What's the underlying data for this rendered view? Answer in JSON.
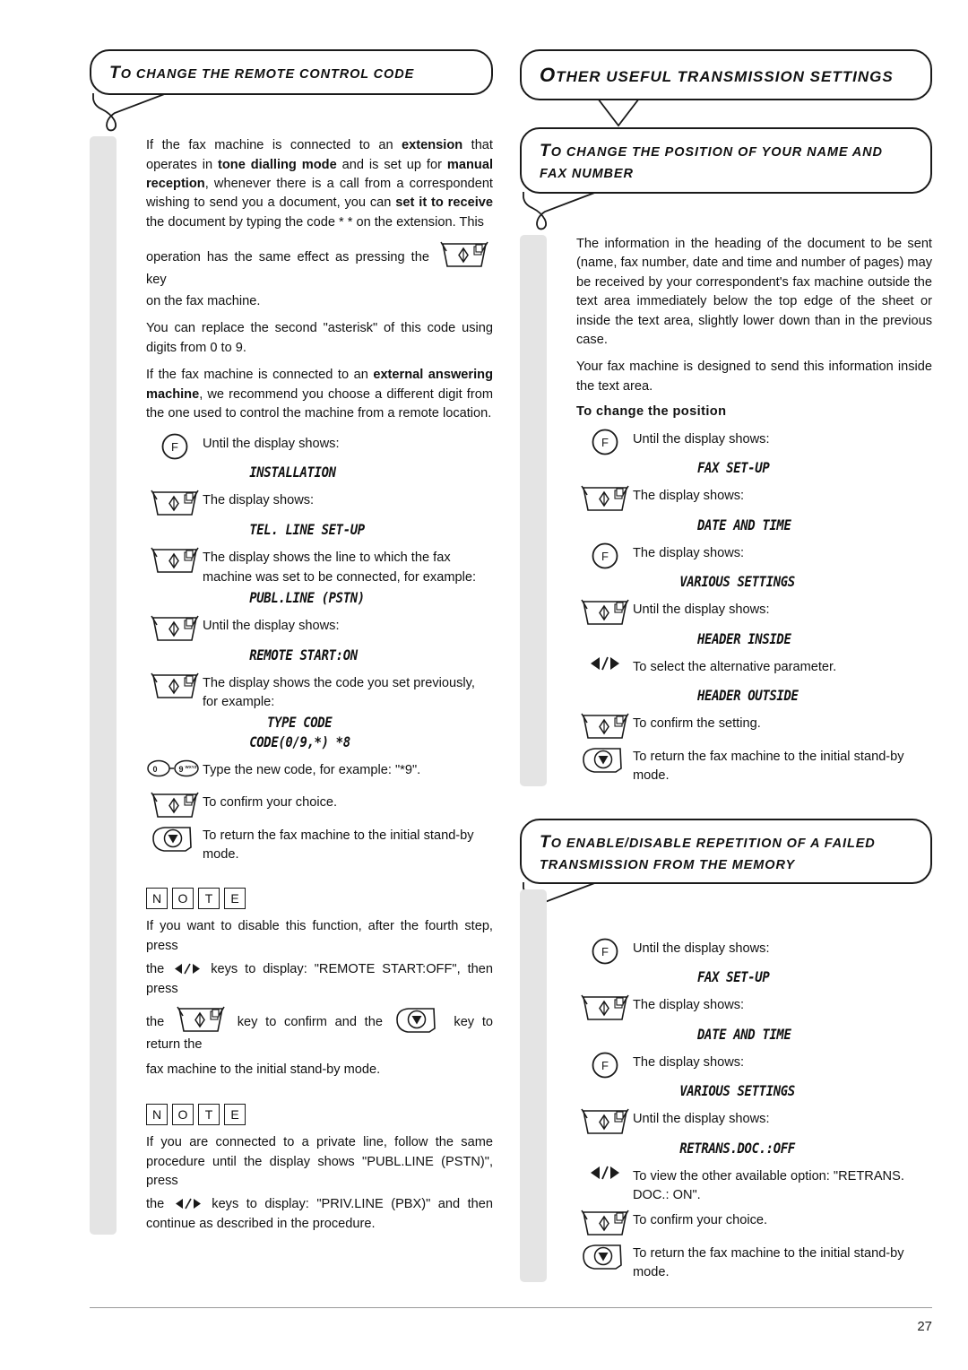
{
  "page": {
    "number": "27"
  },
  "left": {
    "header": {
      "cap": "T",
      "rest": "o change the remote control code"
    },
    "intro": [
      {
        "runs": [
          {
            "t": "If the fax machine is connected to an ",
            "b": false
          },
          {
            "t": "extension",
            "b": true
          },
          {
            "t": " that operates in ",
            "b": false
          },
          {
            "t": "tone dialling mode",
            "b": true
          },
          {
            "t": " and is set up for ",
            "b": false
          },
          {
            "t": "manual reception",
            "b": true
          },
          {
            "t": ", whenever there is a call from a  correspondent wishing to send you a document, you can ",
            "b": false
          },
          {
            "t": "set it to receive",
            "b": true
          },
          {
            "t": " the document by typing the code * * on the extension. This",
            "b": false
          }
        ]
      }
    ],
    "para_key_before": "operation has the same effect as pressing the",
    "para_key_after": "key",
    "para_key_line2": "on the fax machine.",
    "para_asterisk": "You can replace the second \"asterisk\" of this code using digits from 0 to 9.",
    "para_ansmachine": [
      {
        "t": "If the fax machine is connected to an ",
        "b": false
      },
      {
        "t": "external answering machine",
        "b": true
      },
      {
        "t": ", we recommend you choose a different digit from the one used to control the machine from a remote location.",
        "b": false
      }
    ],
    "steps": [
      {
        "key": "f-key",
        "desc": "Until the display shows:",
        "lcd": "INSTALLATION",
        "lcd_indent": "ind3"
      },
      {
        "key": "start-key",
        "desc": "The display shows:",
        "lcd": "TEL. LINE SET-UP",
        "lcd_indent": "ind3"
      },
      {
        "key": "start-key",
        "desc": "The display shows the line to which the fax machine was set to be connected, for example:",
        "lcd": "PUBL.LINE (PSTN)",
        "lcd_indent": "ind3"
      },
      {
        "key": "start-key",
        "desc": "Until the display shows:",
        "lcd": "REMOTE START:ON",
        "lcd_indent": "ind3"
      },
      {
        "key": "start-key",
        "desc": "The display shows the code you set previously, for example:",
        "lcd": "TYPE CODE",
        "lcd_indent": "ind4",
        "lcd2": "CODE(0/9,*)  *8",
        "lcd2_indent": "ind3"
      },
      {
        "key": "keypad-0-9",
        "desc": "Type the new code, for example: \"*9\".",
        "lcd": ""
      },
      {
        "key": "start-key",
        "desc": "To confirm your choice.",
        "lcd": ""
      },
      {
        "key": "stop-key",
        "desc": "To return the fax machine to the initial stand-by mode.",
        "lcd": ""
      }
    ],
    "note1": {
      "letters": [
        "N",
        "O",
        "T",
        "E"
      ],
      "line1": "If you want to disable this function, after the fourth step, press",
      "line2_a": "the",
      "line2_b": "keys to display: \"REMOTE START:OFF\", then press",
      "line3_a": "the",
      "line3_b": "key to confirm and the",
      "line3_c": "key to return the",
      "line4": "fax machine to the initial stand-by mode."
    },
    "note2": {
      "letters": [
        "N",
        "O",
        "T",
        "E"
      ],
      "line1": "If you are connected to a private line, follow the same procedure until the display shows \"PUBL.LINE (PSTN)\", press",
      "line2_a": "the",
      "line2_b": "keys to display: \"PRIV.LINE (PBX)\" and then continue as described in the procedure."
    }
  },
  "right": {
    "header_main": {
      "cap": "O",
      "rest": "ther useful transmission settings"
    },
    "header_sub1": {
      "cap": "T",
      "rest": "o change the position of your name and fax number"
    },
    "intro1": "The information in the heading of the document to be sent (name, fax number, date and time and number of pages) may be received by your correspondent's fax machine outside the text area immediately below the top edge of the sheet or inside the text area, slightly lower down than in the previous case.",
    "intro2": "Your fax machine is designed to send this information inside the text area.",
    "subheading": "To change the position",
    "steps1": [
      {
        "key": "f-key",
        "desc": "Until the display shows:",
        "lcd": "FAX SET-UP",
        "lcd_indent": "ind4"
      },
      {
        "key": "start-key",
        "desc": "The display shows:",
        "lcd": "DATE AND TIME",
        "lcd_indent": "ind4"
      },
      {
        "key": "f-key",
        "desc": "The display shows:",
        "lcd": "VARIOUS SETTINGS",
        "lcd_indent": "ind3"
      },
      {
        "key": "start-key",
        "desc": "Until the display shows:",
        "lcd": "HEADER INSIDE",
        "lcd_indent": "ind4"
      },
      {
        "key": "arrows",
        "desc": "To select the alternative parameter.",
        "lcd": "HEADER OUTSIDE",
        "lcd_indent": "ind4"
      },
      {
        "key": "start-key",
        "desc": "To confirm the setting.",
        "lcd": ""
      },
      {
        "key": "stop-key",
        "desc": "To return the fax machine to the initial stand-by mode.",
        "lcd": ""
      }
    ],
    "header_sub2": {
      "cap": "T",
      "rest": "o enable/disable repetition of a failed transmission from the memory"
    },
    "steps2": [
      {
        "key": "f-key",
        "desc": "Until the display shows:",
        "lcd": "FAX SET-UP",
        "lcd_indent": "ind4"
      },
      {
        "key": "start-key",
        "desc": "The display shows:",
        "lcd": "DATE AND TIME",
        "lcd_indent": "ind4"
      },
      {
        "key": "f-key",
        "desc": "The display shows:",
        "lcd": "VARIOUS SETTINGS",
        "lcd_indent": "ind3"
      },
      {
        "key": "start-key",
        "desc": "Until the display shows:",
        "lcd": "RETRANS.DOC.:OFF",
        "lcd_indent": "ind3"
      },
      {
        "key": "arrows",
        "desc": "To view the other available option: \"RETRANS. DOC.: ON\".",
        "lcd": ""
      },
      {
        "key": "start-key",
        "desc": "To confirm your choice.",
        "lcd": ""
      },
      {
        "key": "stop-key",
        "desc": "To return the fax machine to the initial stand-by mode.",
        "lcd": ""
      }
    ]
  },
  "icons": {
    "f_key": "f-key-icon",
    "start_key": "start-key-icon",
    "stop_key": "stop-key-icon",
    "keypad": "keypad-0-9-icon",
    "arrows": "left-right-arrows-icon"
  },
  "colors": {
    "strip": "#e4e4e4",
    "ink": "#1a1a1a",
    "rule": "#999999"
  }
}
